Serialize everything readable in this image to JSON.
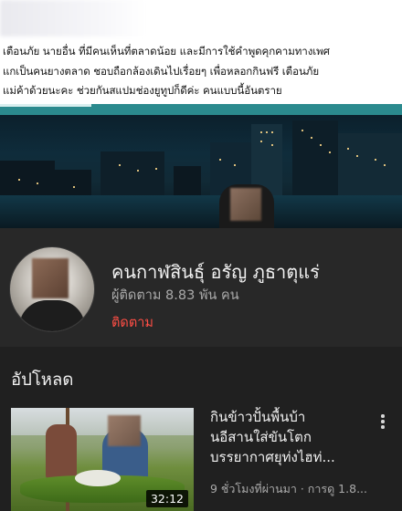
{
  "post": {
    "lines": [
      "เตือนภัย นายอื่น ที่มีคนเห็นที่ตลาดน้อย และมีการใช้คำพูดคุกคามทางเพศ",
      "แกเป็นคนยางตลาด ชอบถือกล้องเดินไปเรื่อยๆ เพื่อหลอกกินฟรี เตือนภัย",
      "แม่ค้าด้วยนะคะ ช่วยกันสแปมช่องยูทูปก็ดีค่ะ คนแบบนี้อันตราย"
    ]
  },
  "channel": {
    "name": "คนกาฬสินธุ์ อรัญ ภูธาตุแร่",
    "subscribers": "ผู้ติดตาม 8.83 พัน คน",
    "subscribe_label": "ติดตาม"
  },
  "uploads": {
    "section_title": "อัปโหลด",
    "videos": [
      {
        "title_lines": [
          "กินข้าวปั้นพื้นบ้า",
          "นอีสานใส่ขันโตก",
          "บรรยากาศยุท่งไฮท่..."
        ],
        "meta": "9 ชั่วโมงที่ผ่านมา · การดู 1.8...",
        "duration": "32:12"
      }
    ]
  },
  "colors": {
    "accent": "#ff4e45",
    "background": "#202020",
    "channel_bar": "#282828",
    "teal_bar": "#2b8a8e"
  },
  "icons": {
    "more": "more-vert-icon"
  }
}
